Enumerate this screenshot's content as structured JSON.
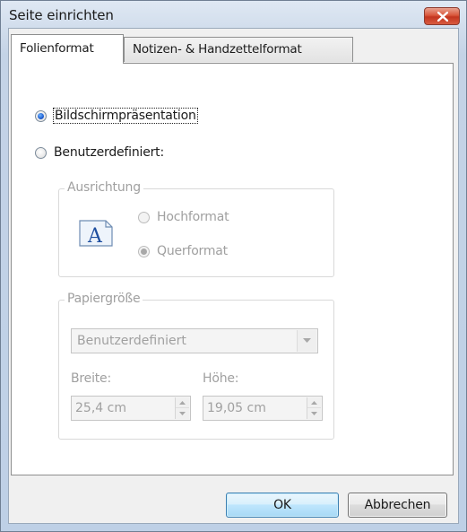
{
  "window": {
    "title": "Seite einrichten"
  },
  "tabs": [
    {
      "label": "Folienformat",
      "active": true
    },
    {
      "label": "Notizen- & Handzettelformat",
      "active": false
    }
  ],
  "slide_size": {
    "option_screen": {
      "label": "Bildschirmpräsentation",
      "checked": true
    },
    "option_custom": {
      "label": "Benutzerdefiniert:",
      "checked": false
    }
  },
  "orientation": {
    "legend": "Ausrichtung",
    "portrait": {
      "label": "Hochformat",
      "checked": false
    },
    "landscape": {
      "label": "Querformat",
      "checked": true
    },
    "icon": "page-landscape-icon"
  },
  "paper_size": {
    "legend": "Papiergröße",
    "selected": "Benutzerdefiniert",
    "width_label": "Breite:",
    "width_value": "25,4 cm",
    "height_label": "Höhe:",
    "height_value": "19,05 cm"
  },
  "buttons": {
    "ok": "OK",
    "cancel": "Abbrechen"
  },
  "colors": {
    "accent": "#1f5fd1",
    "close_button": "#c3351f",
    "ok_border": "#3c7fb1"
  }
}
